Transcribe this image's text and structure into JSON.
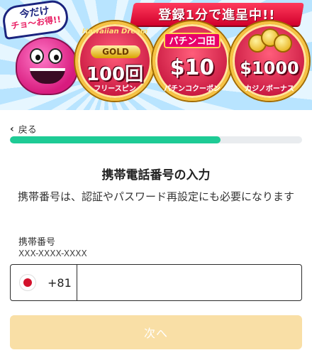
{
  "banner": {
    "speech": {
      "line1": "今だけ",
      "line2": "チョ〜お得!!"
    },
    "ribbon": "登録1分で進呈中!!",
    "offers": [
      {
        "top": "Hawaiian Dream",
        "badge": "GOLD",
        "amount": "100回",
        "sub": "フリースピン"
      },
      {
        "top": "パチンコ田",
        "amount": "$10",
        "sub": "パチンコクーポン"
      },
      {
        "amount": "$1000",
        "sub": "カジノボーナス"
      }
    ]
  },
  "nav": {
    "back_label": "戻る"
  },
  "progress": {
    "value": 0.72
  },
  "form": {
    "title": "携帯電話番号の入力",
    "description": "携帯番号は、認証やパスワード再設定にも必要になります",
    "phone_label": "携帯番号",
    "phone_hint": "XXX-XXXX-XXXX",
    "country_code": "+81",
    "country_flag": "japan-flag",
    "phone_value": "",
    "phone_placeholder": "",
    "next_label": "次へ"
  },
  "colors": {
    "progress": "#1ecb95",
    "next_disabled": "#f9dfa6"
  }
}
